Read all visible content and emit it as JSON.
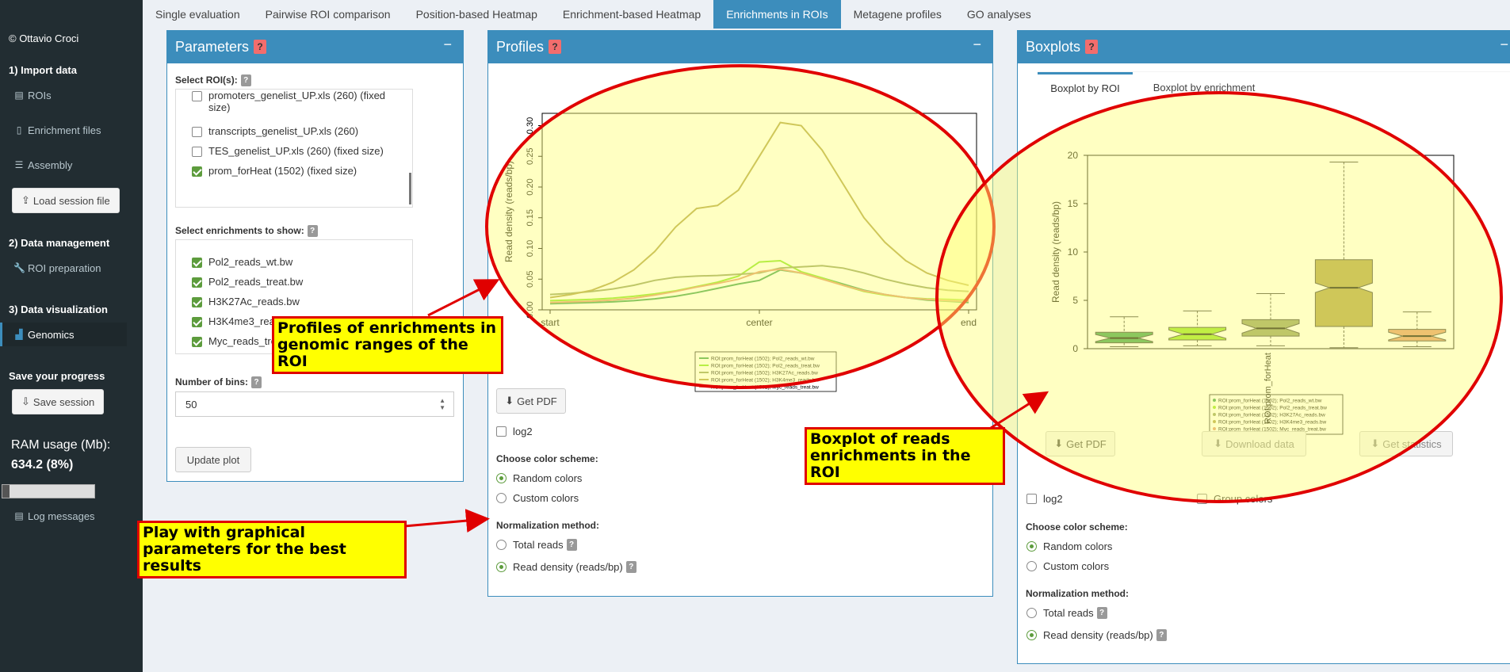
{
  "sidebar": {
    "copyright": "© Ottavio Croci",
    "section1": "1) Import data",
    "rois": "ROIs",
    "enrichment_files": "Enrichment files",
    "assembly": "Assembly",
    "load_session": "Load session file",
    "section2": "2) Data management",
    "roi_preparation": "ROI preparation",
    "section3": "3) Data visualization",
    "genomics": "Genomics",
    "save_progress": "Save your progress",
    "save_session": "Save session",
    "ram_label": "RAM usage (Mb):",
    "ram_value": "634.2 (8%)",
    "ram_fraction": 0.08,
    "log_messages": "Log messages"
  },
  "tabs": [
    "Single evaluation",
    "Pairwise ROI comparison",
    "Position-based Heatmap",
    "Enrichment-based Heatmap",
    "Enrichments in ROIs",
    "Metagene profiles",
    "GO analyses"
  ],
  "parameters": {
    "title": "Parameters",
    "select_rois": "Select ROI(s):",
    "rois": [
      {
        "label": "promoters_genelist_UP.xls (260) (fixed size)",
        "checked": false
      },
      {
        "label": "transcripts_genelist_UP.xls (260)",
        "checked": false
      },
      {
        "label": "TES_genelist_UP.xls (260) (fixed size)",
        "checked": false
      },
      {
        "label": "prom_forHeat (1502) (fixed size)",
        "checked": true
      }
    ],
    "select_enrichments": "Select enrichments to show:",
    "enrichments": [
      {
        "label": "Pol2_reads_wt.bw",
        "checked": true
      },
      {
        "label": "Pol2_reads_treat.bw",
        "checked": true
      },
      {
        "label": "H3K27Ac_reads.bw",
        "checked": true
      },
      {
        "label": "H3K4me3_reads.bw",
        "checked": true
      },
      {
        "label": "Myc_reads_treat.bw",
        "checked": true
      }
    ],
    "num_bins_label": "Number of bins:",
    "num_bins_value": "50",
    "update_plot": "Update plot"
  },
  "profiles": {
    "title": "Profiles",
    "get_pdf": "Get PDF",
    "log2": "log2",
    "color_scheme_label": "Choose color scheme:",
    "color_options": [
      "Random colors",
      "Custom colors"
    ],
    "normalization_label": "Normalization method:",
    "norm_options": [
      "Total reads",
      "Read density (reads/bp)"
    ]
  },
  "boxplots": {
    "title": "Boxplots",
    "subtabs": [
      "Boxplot by ROI",
      "Boxplot by enrichment"
    ],
    "get_pdf": "Get PDF",
    "download_data": "Download data",
    "get_statistics": "Get statistics",
    "log2": "log2",
    "group_colors": "Group colors",
    "color_scheme_label": "Choose color scheme:",
    "color_options": [
      "Random colors",
      "Custom colors"
    ],
    "normalization_label": "Normalization method:",
    "norm_options": [
      "Total reads",
      "Read density (reads/bp)"
    ]
  },
  "callouts": {
    "profiles": "Profiles of enrichments in genomic ranges of the ROI",
    "boxplot": "Boxplot of reads enrichments in the ROI",
    "params": "Play with graphical parameters for the best results"
  },
  "chart_data": [
    {
      "type": "line",
      "ylabel": "Read density (reads/bp)",
      "xticks": [
        "start",
        "center",
        "end"
      ],
      "ylim": [
        0,
        0.32
      ],
      "yticks": [
        0.0,
        0.05,
        0.1,
        0.15,
        0.2,
        0.25,
        0.3
      ],
      "legend_position": "bottom",
      "series": [
        {
          "name": "ROI:prom_forHeat (1502); Pol2_reads_wt.bw",
          "color": "#2e9a4a",
          "values": [
            0.01,
            0.011,
            0.012,
            0.013,
            0.015,
            0.018,
            0.022,
            0.028,
            0.035,
            0.042,
            0.048,
            0.065,
            0.06,
            0.052,
            0.042,
            0.032,
            0.025,
            0.02,
            0.016,
            0.014,
            0.012
          ]
        },
        {
          "name": "ROI:prom_forHeat (1502); Pol2_reads_treat.bw",
          "color": "#7ee01a",
          "values": [
            0.015,
            0.016,
            0.017,
            0.019,
            0.022,
            0.026,
            0.031,
            0.038,
            0.045,
            0.055,
            0.078,
            0.08,
            0.062,
            0.052,
            0.04,
            0.03,
            0.024,
            0.02,
            0.018,
            0.017,
            0.016
          ]
        },
        {
          "name": "ROI:prom_forHeat (1502); H3K27Ac_reads.bw",
          "color": "#8a9a5b",
          "values": [
            0.025,
            0.027,
            0.03,
            0.034,
            0.04,
            0.048,
            0.053,
            0.055,
            0.056,
            0.058,
            0.06,
            0.068,
            0.07,
            0.072,
            0.068,
            0.06,
            0.05,
            0.042,
            0.036,
            0.032,
            0.03
          ]
        },
        {
          "name": "ROI:prom_forHeat (1502); H3K4me3_reads.bw",
          "color": "#a89a40",
          "values": [
            0.02,
            0.025,
            0.032,
            0.045,
            0.065,
            0.095,
            0.135,
            0.165,
            0.17,
            0.195,
            0.25,
            0.305,
            0.3,
            0.26,
            0.205,
            0.15,
            0.11,
            0.08,
            0.06,
            0.048,
            0.04
          ]
        },
        {
          "name": "ROI:prom_forHeat (1502); Myc_reads_treat.bw",
          "color": "#e0906a",
          "values": [
            0.012,
            0.013,
            0.014,
            0.016,
            0.019,
            0.024,
            0.03,
            0.037,
            0.043,
            0.05,
            0.062,
            0.066,
            0.06,
            0.05,
            0.04,
            0.031,
            0.025,
            0.02,
            0.017,
            0.015,
            0.014
          ]
        }
      ]
    },
    {
      "type": "box",
      "ylabel": "Read density (reads/bp)",
      "xlabel": "ROI:prom_forHeat",
      "ylim": [
        0,
        20
      ],
      "yticks": [
        0,
        5,
        10,
        15,
        20
      ],
      "legend_position": "bottom",
      "series": [
        {
          "name": "ROI:prom_forHeat (1502); Pol2_reads_wt.bw",
          "color": "#2e9a4a",
          "min": 0.2,
          "q1": 0.6,
          "median": 1.1,
          "q3": 1.7,
          "max": 3.3
        },
        {
          "name": "ROI:prom_forHeat (1502); Pol2_reads_treat.bw",
          "color": "#8ee01a",
          "min": 0.3,
          "q1": 0.9,
          "median": 1.5,
          "q3": 2.2,
          "max": 3.9
        },
        {
          "name": "ROI:prom_forHeat (1502); H3K27Ac_reads.bw",
          "color": "#8a9a5b",
          "min": 0.3,
          "q1": 1.3,
          "median": 2.1,
          "q3": 3.0,
          "max": 5.7
        },
        {
          "name": "ROI:prom_forHeat (1502); H3K4me3_reads.bw",
          "color": "#a89a40",
          "min": 0.1,
          "q1": 2.3,
          "median": 6.3,
          "q3": 9.2,
          "max": 19.3
        },
        {
          "name": "ROI:prom_forHeat (1502); Myc_reads_treat.bw",
          "color": "#e0906a",
          "min": 0.2,
          "q1": 0.8,
          "median": 1.3,
          "q3": 2.0,
          "max": 3.8
        }
      ]
    }
  ]
}
